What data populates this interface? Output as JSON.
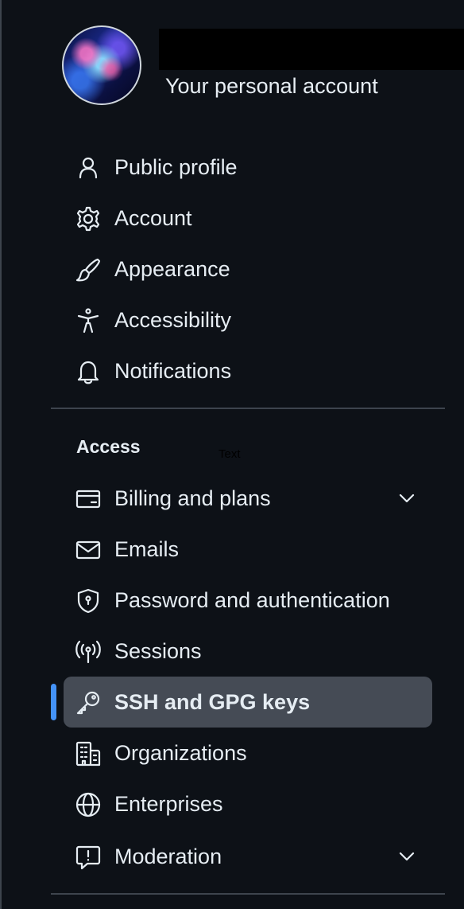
{
  "account": {
    "subtitle": "Your personal account"
  },
  "settings_nav": {
    "primary_items": [
      {
        "label": "Public profile",
        "icon": "person-icon"
      },
      {
        "label": "Account",
        "icon": "gear-icon"
      },
      {
        "label": "Appearance",
        "icon": "paintbrush-icon"
      },
      {
        "label": "Accessibility",
        "icon": "accessibility-icon"
      },
      {
        "label": "Notifications",
        "icon": "bell-icon"
      }
    ],
    "access_heading": "Access",
    "stray_label": "Text",
    "access_items": [
      {
        "label": "Billing and plans",
        "icon": "credit-card-icon",
        "expandable": true
      },
      {
        "label": "Emails",
        "icon": "mail-icon"
      },
      {
        "label": "Password and authentication",
        "icon": "shield-lock-icon"
      },
      {
        "label": "Sessions",
        "icon": "broadcast-icon"
      },
      {
        "label": "SSH and GPG keys",
        "icon": "key-icon",
        "selected": true
      },
      {
        "label": "Organizations",
        "icon": "organization-icon"
      },
      {
        "label": "Enterprises",
        "icon": "globe-icon"
      },
      {
        "label": "Moderation",
        "icon": "report-icon",
        "expandable": true
      }
    ]
  },
  "colors": {
    "background": "#0d1117",
    "text": "#e6edf3",
    "selected_background": "#454b55",
    "active_indicator": "#4493f8",
    "divider": "#3d444d"
  }
}
